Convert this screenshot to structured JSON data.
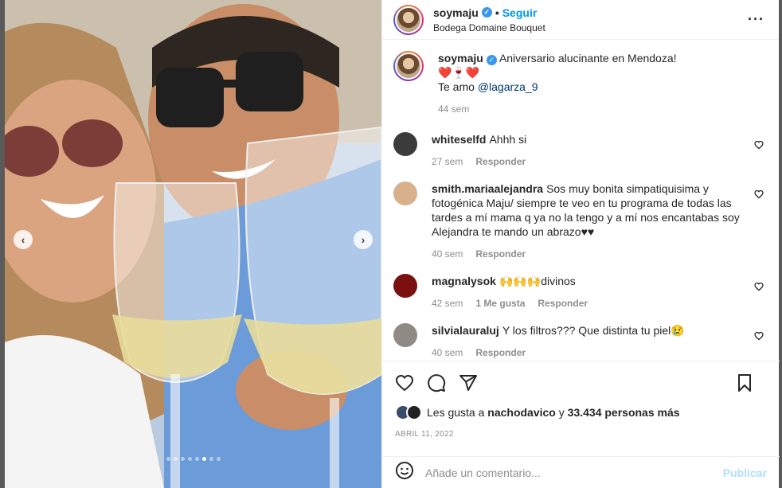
{
  "post": {
    "username": "soymaju",
    "follow_label": "Seguir",
    "separator": "•",
    "location": "Bodega Domaine Bouquet",
    "more_icon": "more-horizontal-icon"
  },
  "caption": {
    "username": "soymaju",
    "text": "Aniversario alucinante en Mendoza!",
    "emojis": "❤️🍷❤️",
    "line3_prefix": "Te amo ",
    "mention": "@lagarza_9",
    "time": "44 sem"
  },
  "comments": [
    {
      "username": "whiteselfd",
      "text": "Ahhh si",
      "time": "27 sem",
      "likes": "",
      "reply": "Responder",
      "avatar_color": "#3b3b3b"
    },
    {
      "username": "smith.mariaalejandra",
      "text": "Sos muy bonita simpatiquisima y fotogénica Maju/ siempre te veo en tu programa de todas las tardes a mí mama q ya no la tengo y a mí nos encantabas soy Alejandra te mando un abrazo♥♥",
      "time": "40 sem",
      "likes": "",
      "reply": "Responder",
      "avatar_color": "#d9b08c"
    },
    {
      "username": "magnalysok",
      "text": "🙌🙌🙌divinos",
      "time": "42 sem",
      "likes": "1 Me gusta",
      "reply": "Responder",
      "avatar_color": "#7a1010"
    },
    {
      "username": "silvialauraluj",
      "text": "Y los filtros??? Que distinta tu piel😢",
      "time": "40 sem",
      "likes": "",
      "reply": "Responder",
      "avatar_color": "#8f8a84"
    }
  ],
  "actions": {
    "like_icon": "heart-icon",
    "comment_icon": "comment-icon",
    "share_icon": "share-icon",
    "save_icon": "bookmark-icon"
  },
  "likes": {
    "prefix": "Les gusta a ",
    "user": "nachodavico",
    "middle": " y ",
    "count": "33.434 personas más"
  },
  "date": "ABRIL 11, 2022",
  "add_comment": {
    "placeholder": "Añade un comentario...",
    "publish_label": "Publicar"
  },
  "carousel": {
    "prev_label": "‹",
    "next_label": "›",
    "dots": 8,
    "active_dot": 5
  },
  "colors": {
    "accent": "#0095f6",
    "verified": "#3897f0",
    "publish_disabled": "#b2dffc"
  }
}
